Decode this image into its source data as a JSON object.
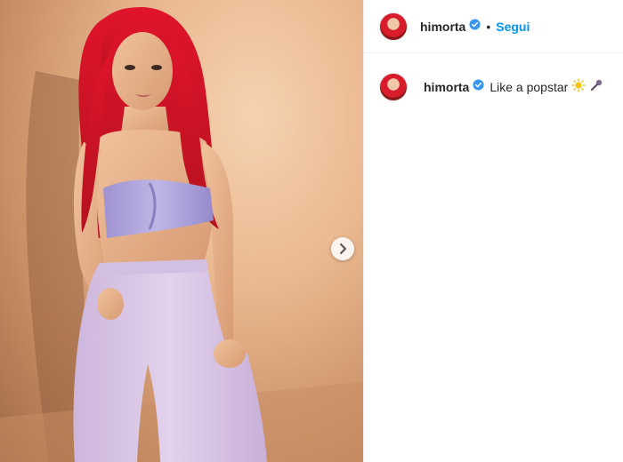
{
  "post": {
    "author": {
      "username": "himorta",
      "verified": true,
      "follow_label": "Segui",
      "separator": "•"
    },
    "caption": {
      "username": "himorta",
      "text": "Like a popstar",
      "emojis": [
        "sun-emoji",
        "microphone-emoji"
      ]
    },
    "media": {
      "description_icon": "photo",
      "carousel_next_icon": "chevron-right-icon"
    },
    "colors": {
      "link_blue": "#0095f6",
      "verified_blue": "#3897f0",
      "text": "#262626",
      "hair_red": "#d81c2a",
      "top_lilac": "#a99ad8",
      "jeans_lilac": "#d8c4e6"
    }
  }
}
